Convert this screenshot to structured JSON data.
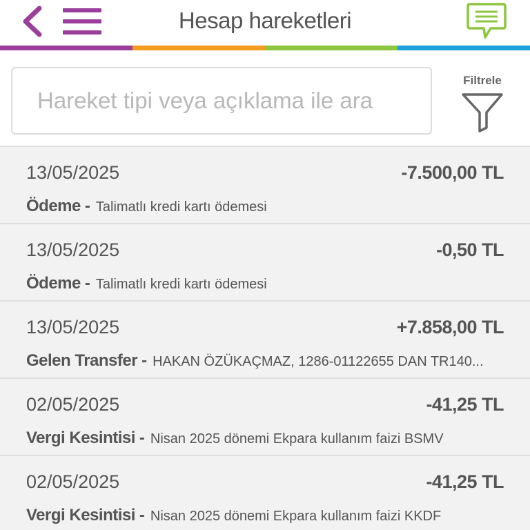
{
  "header": {
    "title": "Hesap hareketleri",
    "back_icon": "chevron-left-icon",
    "menu_icon": "hamburger-menu-icon",
    "chat_icon": "chat-bubble-icon",
    "back_color": "#9b3e9b",
    "menu_color": "#9b3e9b",
    "chat_color": "#8cc63f"
  },
  "color_bar": [
    "#9b3e9b",
    "#f39c1f",
    "#8cc63f",
    "#1ea2dd"
  ],
  "search": {
    "placeholder": "Hareket tipi veya açıklama ile ara",
    "value": ""
  },
  "filter": {
    "label": "Filtrele",
    "icon": "funnel-icon"
  },
  "transactions": [
    {
      "date": "13/05/2025",
      "amount": "-7.500,00 TL",
      "type": "Ödeme",
      "description": "Talimatlı kredi kartı ödemesi"
    },
    {
      "date": "13/05/2025",
      "amount": "-0,50 TL",
      "type": "Ödeme",
      "description": "Talimatlı kredi kartı ödemesi"
    },
    {
      "date": "13/05/2025",
      "amount": "+7.858,00 TL",
      "type": "Gelen Transfer",
      "description": "HAKAN ÖZÜKAÇMAZ, 1286-01122655 DAN TR140..."
    },
    {
      "date": "02/05/2025",
      "amount": "-41,25 TL",
      "type": "Vergi Kesintisi",
      "description": "Nisan 2025 dönemi Ekpara kullanım faizi BSMV"
    },
    {
      "date": "02/05/2025",
      "amount": "-41,25 TL",
      "type": "Vergi Kesintisi",
      "description": "Nisan 2025 dönemi Ekpara kullanım faizi KKDF"
    }
  ]
}
